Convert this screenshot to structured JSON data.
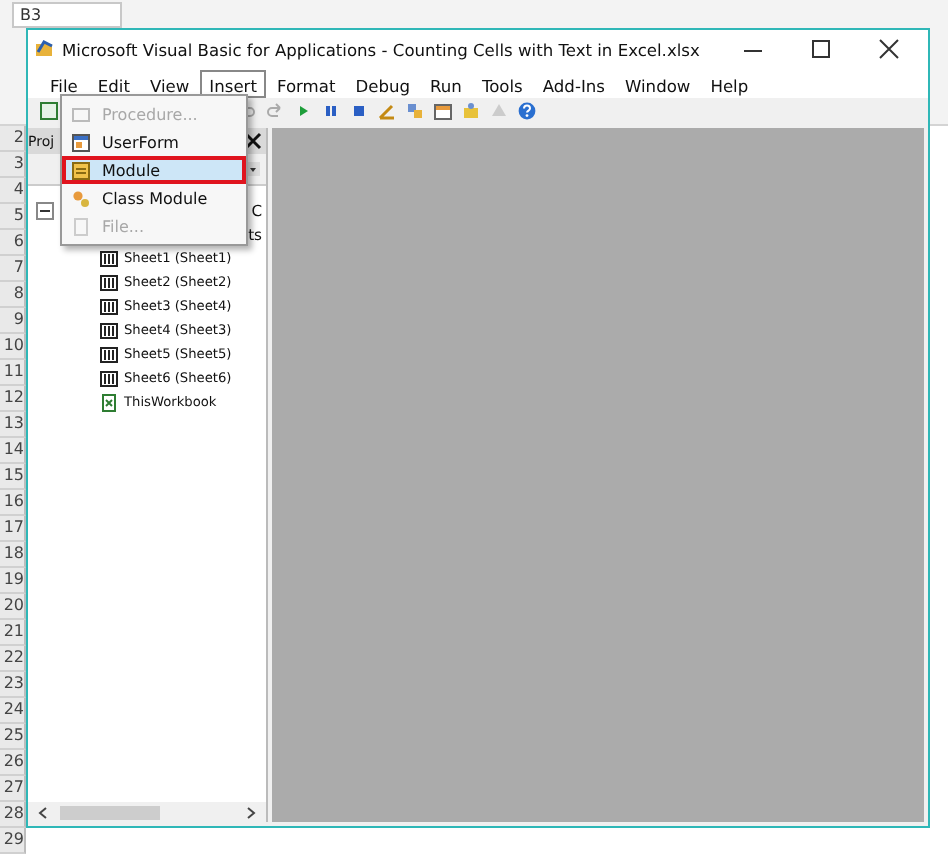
{
  "excel": {
    "name_box": "B3",
    "row_numbers": [
      "2",
      "3",
      "4",
      "5",
      "6",
      "7",
      "8",
      "9",
      "10",
      "11",
      "12",
      "13",
      "14",
      "15",
      "16",
      "17",
      "18",
      "19",
      "20",
      "21",
      "22",
      "23",
      "24",
      "25",
      "26",
      "27",
      "28",
      "29"
    ]
  },
  "window": {
    "title": "Microsoft Visual Basic for Applications - Counting Cells with Text in Excel.xlsx"
  },
  "menu_bar": [
    {
      "label": "File",
      "selected": false
    },
    {
      "label": "Edit",
      "selected": false
    },
    {
      "label": "View",
      "selected": false
    },
    {
      "label": "Insert",
      "selected": true
    },
    {
      "label": "Format",
      "selected": false
    },
    {
      "label": "Debug",
      "selected": false
    },
    {
      "label": "Run",
      "selected": false
    },
    {
      "label": "Tools",
      "selected": false
    },
    {
      "label": "Add-Ins",
      "selected": false
    },
    {
      "label": "Window",
      "selected": false
    },
    {
      "label": "Help",
      "selected": false
    }
  ],
  "insert_menu": [
    {
      "label": "Procedure...",
      "kind": "procedure",
      "disabled": true,
      "selected": false
    },
    {
      "label": "UserForm",
      "kind": "userform",
      "disabled": false,
      "selected": false
    },
    {
      "label": "Module",
      "kind": "module",
      "disabled": false,
      "selected": true
    },
    {
      "label": "Class Module",
      "kind": "class",
      "disabled": false,
      "selected": false
    },
    {
      "label": "File...",
      "kind": "file",
      "disabled": true,
      "selected": false
    }
  ],
  "project_panel": {
    "title": "Proj",
    "tree": [
      {
        "label": "C",
        "expanded": true,
        "children": [
          {
            "label": "ts",
            "children": [
              {
                "label": "Sheet1 (Sheet1)",
                "kind": "sheet"
              },
              {
                "label": "Sheet2 (Sheet2)",
                "kind": "sheet"
              },
              {
                "label": "Sheet3 (Sheet4)",
                "kind": "sheet"
              },
              {
                "label": "Sheet4 (Sheet3)",
                "kind": "sheet"
              },
              {
                "label": "Sheet5 (Sheet5)",
                "kind": "sheet"
              },
              {
                "label": "Sheet6 (Sheet6)",
                "kind": "sheet"
              },
              {
                "label": "ThisWorkbook",
                "kind": "workbook"
              }
            ]
          }
        ]
      }
    ]
  }
}
